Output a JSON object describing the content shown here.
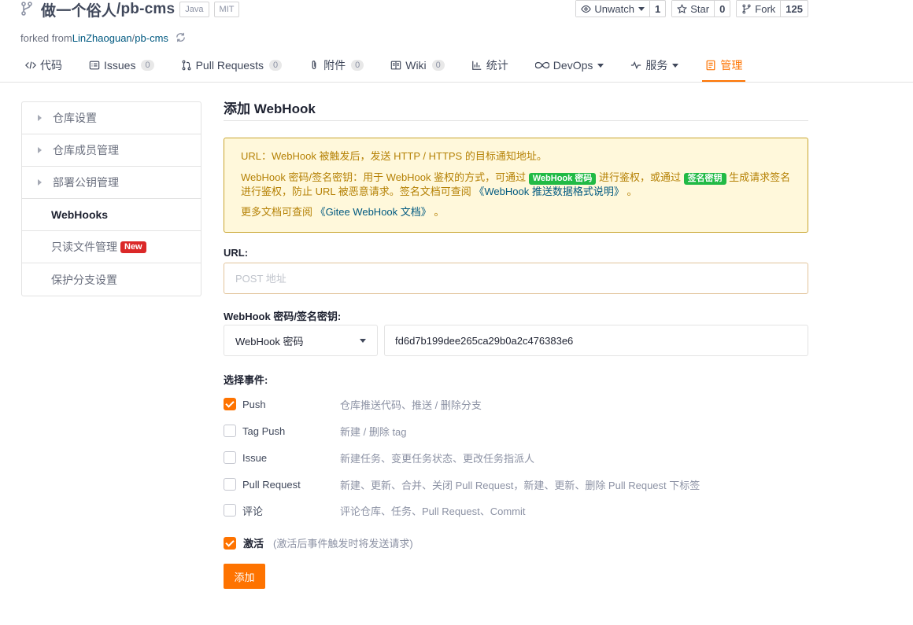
{
  "repo": {
    "owner": "做一个俗人",
    "separator": " / ",
    "name": "pb-cms",
    "tags": [
      "Java",
      "MIT"
    ],
    "forked_prefix": "forked from ",
    "forked_owner": "LinZhaoguan",
    "forked_sep": " / ",
    "forked_repo": "pb-cms"
  },
  "actions": {
    "watch": {
      "label": "Unwatch",
      "count": "1"
    },
    "star": {
      "label": "Star",
      "count": "0"
    },
    "fork": {
      "label": "Fork",
      "count": "125"
    }
  },
  "tabs": [
    {
      "label": "代码",
      "badge": null,
      "icon": "code-icon"
    },
    {
      "label": "Issues",
      "badge": "0",
      "icon": "issues-icon"
    },
    {
      "label": "Pull Requests",
      "badge": "0",
      "icon": "pull-request-icon"
    },
    {
      "label": "附件",
      "badge": "0",
      "icon": "attachment-icon"
    },
    {
      "label": "Wiki",
      "badge": "0",
      "icon": "wiki-icon"
    },
    {
      "label": "统计",
      "badge": null,
      "icon": "stats-icon"
    },
    {
      "label": "DevOps",
      "badge": null,
      "icon": "devops-icon"
    },
    {
      "label": "服务",
      "badge": null,
      "icon": "service-icon"
    },
    {
      "label": "管理",
      "badge": null,
      "icon": "manage-icon"
    }
  ],
  "sidebar": {
    "items": [
      {
        "label": "仓库设置"
      },
      {
        "label": "仓库成员管理"
      },
      {
        "label": "部署公钥管理"
      },
      {
        "label": "WebHooks"
      },
      {
        "label": "只读文件管理",
        "badge": "New"
      },
      {
        "label": "保护分支设置"
      }
    ]
  },
  "main": {
    "title": "添加 WebHook",
    "notice": {
      "line1": "URL：WebHook 被触发后，发送 HTTP / HTTPS 的目标通知地址。",
      "line2_a": "WebHook 密码/签名密钥：用于 WebHook 鉴权的方式，可通过 ",
      "badge1": "WebHook 密码",
      "line2_b": " 进行鉴权，或通过 ",
      "badge2": "签名密钥",
      "line2_c": " 生成请求签名进行鉴权，防止 URL 被恶意请求。签名文档可查阅 ",
      "link1": "《WebHook 推送数据格式说明》",
      "line2_d": " 。",
      "line3_a": "更多文档可查阅 ",
      "link2": "《Gitee WebHook 文档》",
      "line3_b": " 。"
    },
    "url_label": "URL:",
    "url_placeholder": "POST 地址",
    "url_value": "",
    "secret_label": "WebHook 密码/签名密钥:",
    "secret_type": "WebHook 密码",
    "secret_value": "fd6d7b199dee265ca29b0a2c476383e6",
    "events_label": "选择事件:",
    "events": [
      {
        "name": "Push",
        "desc": "仓库推送代码、推送 / 删除分支",
        "checked": true
      },
      {
        "name": "Tag Push",
        "desc": "新建 / 删除 tag",
        "checked": false
      },
      {
        "name": "Issue",
        "desc": "新建任务、变更任务状态、更改任务指派人",
        "checked": false
      },
      {
        "name": "Pull Request",
        "desc": "新建、更新、合并、关闭 Pull Request，新建、更新、删除 Pull Request 下标签",
        "checked": false
      },
      {
        "name": "评论",
        "desc": "评论仓库、任务、Pull Request、Commit",
        "checked": false
      }
    ],
    "activate_label": "激活",
    "activate_hint": "(激活后事件触发时将发送请求)",
    "activate_checked": true,
    "submit_label": "添加"
  },
  "colors": {
    "accent": "#fe7300",
    "link": "#005980",
    "notice_bg": "#fff8db",
    "notice_text": "#b58105",
    "badge_green": "#21ba45",
    "badge_red": "#db2828"
  }
}
